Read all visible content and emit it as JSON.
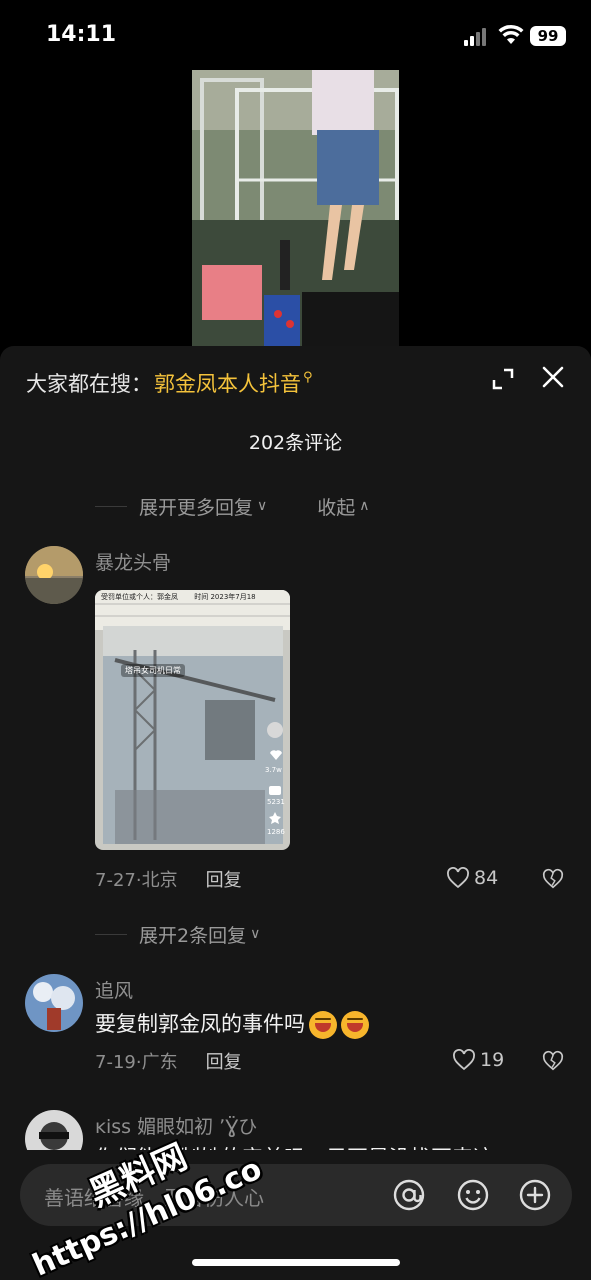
{
  "status_bar": {
    "time": "14:11",
    "battery": "99"
  },
  "search": {
    "prefix": "大家都在搜：",
    "term": "郭金凤本人抖音"
  },
  "comments_header": {
    "title": "202条评论"
  },
  "top_reply_bar": {
    "expand_more": "展开更多回复",
    "collapse": "收起"
  },
  "comments": [
    {
      "user": "暴龙头骨",
      "has_image": true,
      "image_text": {
        "line1": "受罚单位或个人：郭金凤",
        "line2": "时间 2023年7月18",
        "overlay": "塔吊女司机日常",
        "count1": "3.7w",
        "count2": "5231",
        "count3": "1286"
      },
      "date_loc": "7-27·北京",
      "reply": "回复",
      "likes": "84"
    },
    {
      "user": "追风",
      "text": "要复制郭金凤的事件吗",
      "date_loc": "7-19·广东",
      "reply": "回复",
      "likes": "19"
    },
    {
      "user": "ĸiss 媚眼如初 ՚Ɣ̈ひ",
      "text": "你们能复制她的审美吗，只不是没找不来这"
    }
  ],
  "expand_replies": "展开2条回复",
  "input": {
    "placeholder": "善语结善缘，恶言伤人心"
  },
  "watermark": {
    "line1": "黑料网",
    "line2": "https://hl06.co"
  },
  "colors": {
    "accent": "#f5c33b",
    "sheet_bg": "#161616",
    "input_bg": "#2a2a2a"
  },
  "icons": {
    "expand": "fullscreen-icon",
    "close": "close-icon",
    "mention": "at-icon",
    "emoji": "smile-icon",
    "add": "plus-circle-icon",
    "like": "heart-icon",
    "dislike": "broken-heart-icon"
  }
}
